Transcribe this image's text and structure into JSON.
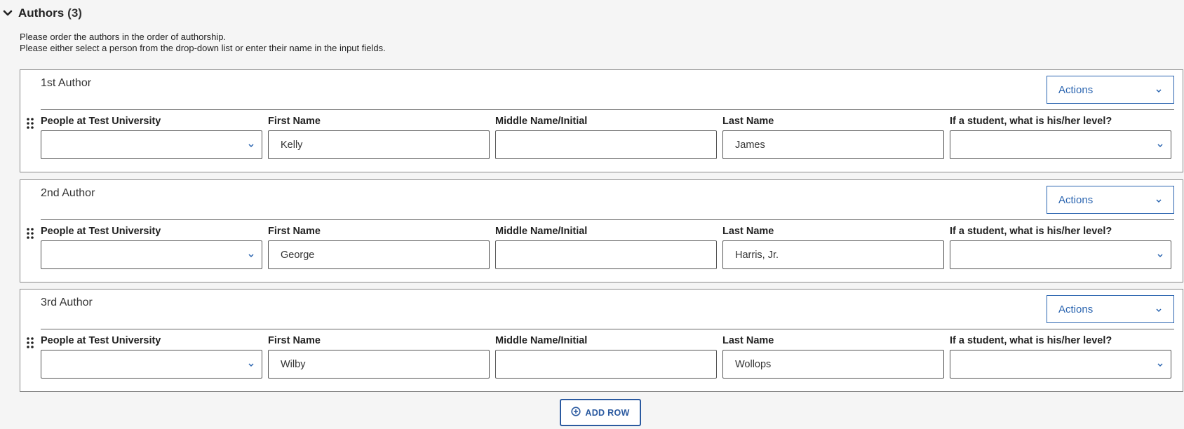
{
  "section": {
    "title": "Authors",
    "count": "(3)"
  },
  "instructions": [
    "Please order the authors in the order of authorship.",
    "Please either select a person from the drop-down list or enter their name in the input fields."
  ],
  "labels": {
    "people": "People at Test University",
    "first_name": "First Name",
    "middle_name": "Middle Name/Initial",
    "last_name": "Last Name",
    "student_level": "If a student, what is his/her level?"
  },
  "authors": [
    {
      "title": "1st Author",
      "actions_label": "Actions",
      "people": "",
      "first_name": "Kelly",
      "middle_name": "",
      "last_name": "James",
      "student_level": ""
    },
    {
      "title": "2nd Author",
      "actions_label": "Actions",
      "people": "",
      "first_name": "George",
      "middle_name": "",
      "last_name": "Harris, Jr.",
      "student_level": ""
    },
    {
      "title": "3rd Author",
      "actions_label": "Actions",
      "people": "",
      "first_name": "Wilby",
      "middle_name": "",
      "last_name": "Wollops",
      "student_level": ""
    }
  ],
  "add_row_label": "ADD ROW",
  "colors": {
    "accent": "#2b65b0",
    "border": "#8a8a8a",
    "background": "#f5f5f5"
  },
  "icons": {
    "collapse": "chevron-down-icon",
    "dropdown": "chevron-down-icon",
    "drag": "drag-handle-icon",
    "add": "plus-circle-icon"
  }
}
